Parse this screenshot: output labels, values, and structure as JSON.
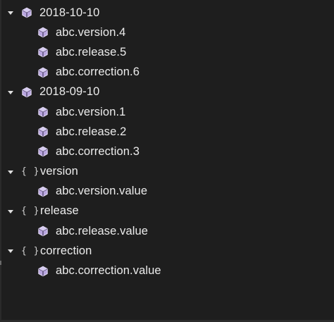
{
  "tree": {
    "nodes": [
      {
        "type": "group",
        "icon": "package-icon",
        "label": "2018-10-10",
        "expanded": true,
        "children": [
          {
            "icon": "package-icon",
            "label": "abc.version.4"
          },
          {
            "icon": "package-icon",
            "label": "abc.release.5"
          },
          {
            "icon": "package-icon",
            "label": "abc.correction.6"
          }
        ]
      },
      {
        "type": "group",
        "icon": "package-icon",
        "label": "2018-09-10",
        "expanded": true,
        "children": [
          {
            "icon": "package-icon",
            "label": "abc.version.1"
          },
          {
            "icon": "package-icon",
            "label": "abc.release.2"
          },
          {
            "icon": "package-icon",
            "label": "abc.correction.3"
          }
        ]
      },
      {
        "type": "group",
        "icon": "braces-icon",
        "braces_glyph": "{ }",
        "label": "version",
        "expanded": true,
        "children": [
          {
            "icon": "package-icon",
            "label": "abc.version.value"
          }
        ]
      },
      {
        "type": "group",
        "icon": "braces-icon",
        "braces_glyph": "{ }",
        "label": "release",
        "expanded": true,
        "children": [
          {
            "icon": "package-icon",
            "label": "abc.release.value"
          }
        ]
      },
      {
        "type": "group",
        "icon": "braces-icon",
        "braces_glyph": "{ }",
        "label": "correction",
        "expanded": true,
        "children": [
          {
            "icon": "package-icon",
            "label": "abc.correction.value"
          }
        ]
      }
    ]
  },
  "colors": {
    "background": "#1e1e1e",
    "text": "#ececec",
    "package_icon_fill": "#b9a6e0",
    "package_icon_stroke": "#e8e0f7",
    "chevron": "#e0e0e0"
  }
}
